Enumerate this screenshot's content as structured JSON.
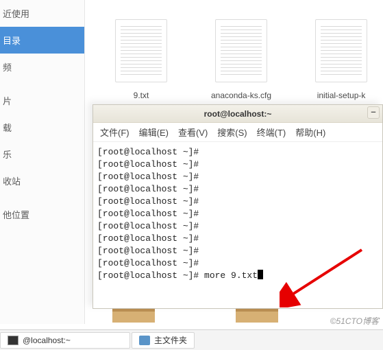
{
  "sidebar": {
    "items": [
      "近使用",
      "目录",
      "频",
      "",
      "片",
      "载",
      "乐",
      "收站",
      "",
      "他位置"
    ],
    "active_index": 1
  },
  "files": [
    {
      "name": "9.txt"
    },
    {
      "name": "anaconda-ks.cfg"
    },
    {
      "name": "initial-setup-k"
    }
  ],
  "terminal": {
    "title": "root@localhost:~",
    "minimize": "–",
    "menu": [
      "文件(F)",
      "编辑(E)",
      "查看(V)",
      "搜索(S)",
      "终端(T)",
      "帮助(H)"
    ],
    "prompt": "[root@localhost ~]#",
    "blank_lines": 10,
    "command": "more 9.txt"
  },
  "taskbar": {
    "items": [
      {
        "label": "@localhost:~"
      },
      {
        "label": "主文件夹"
      }
    ]
  },
  "watermark": "©51CTO博客"
}
